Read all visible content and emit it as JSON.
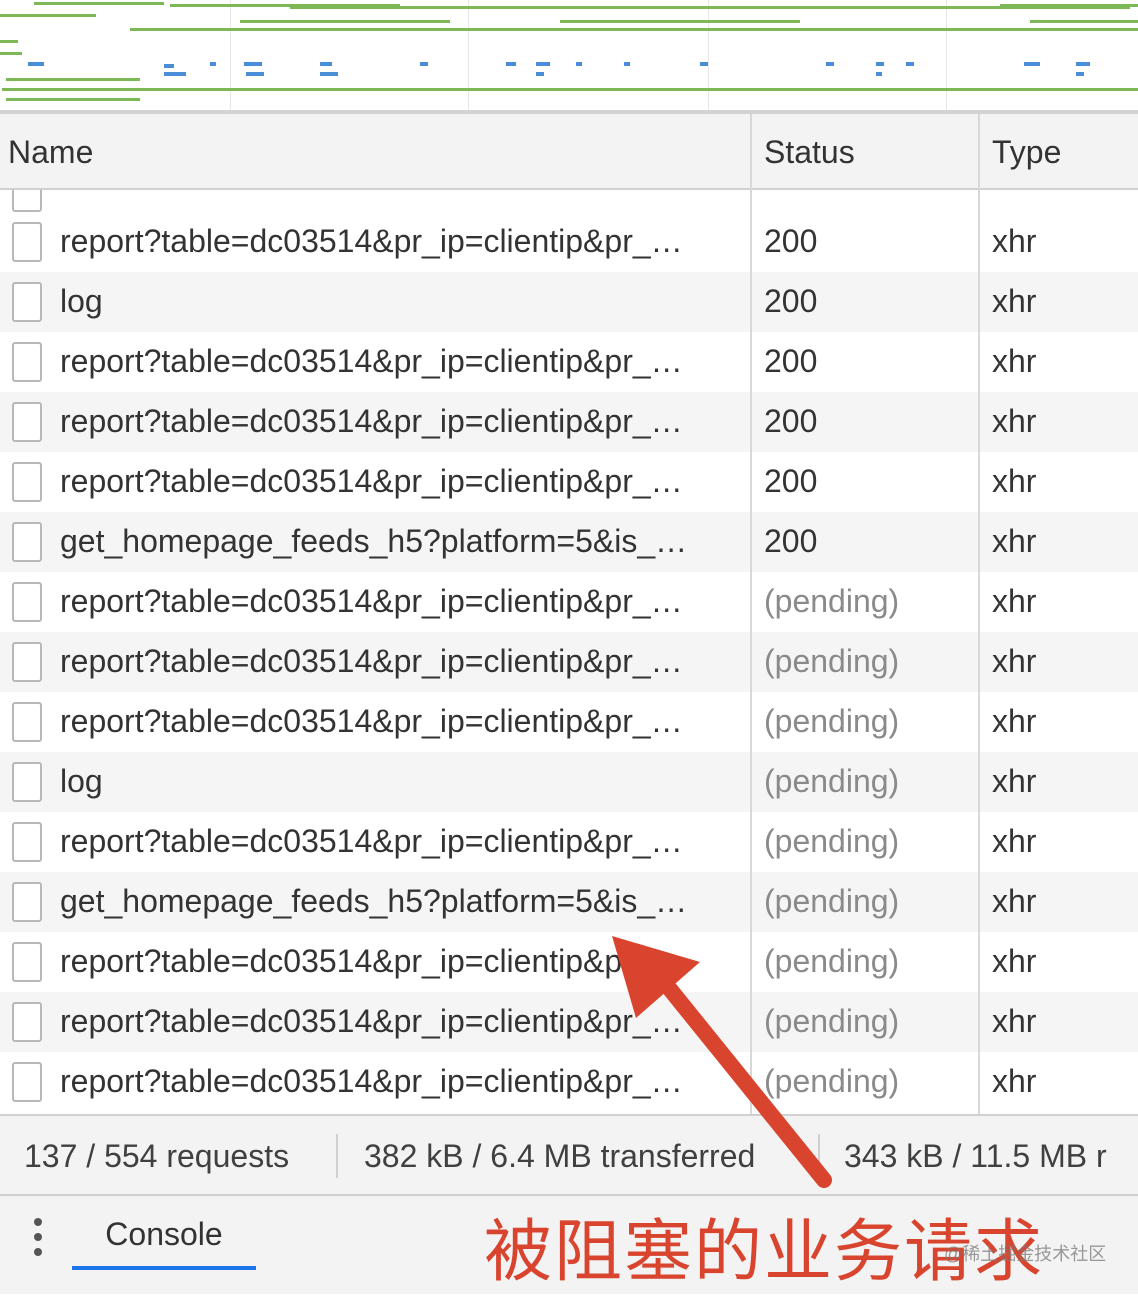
{
  "columns": {
    "name": "Name",
    "status": "Status",
    "type": "Type"
  },
  "rows": [
    {
      "name": "report?table=dc03514&pr_ip=clientip&pr_…",
      "status": "200",
      "type": "xhr"
    },
    {
      "name": "log",
      "status": "200",
      "type": "xhr"
    },
    {
      "name": "report?table=dc03514&pr_ip=clientip&pr_…",
      "status": "200",
      "type": "xhr"
    },
    {
      "name": "report?table=dc03514&pr_ip=clientip&pr_…",
      "status": "200",
      "type": "xhr"
    },
    {
      "name": "report?table=dc03514&pr_ip=clientip&pr_…",
      "status": "200",
      "type": "xhr"
    },
    {
      "name": "get_homepage_feeds_h5?platform=5&is_…",
      "status": "200",
      "type": "xhr"
    },
    {
      "name": "report?table=dc03514&pr_ip=clientip&pr_…",
      "status": "(pending)",
      "type": "xhr"
    },
    {
      "name": "report?table=dc03514&pr_ip=clientip&pr_…",
      "status": "(pending)",
      "type": "xhr"
    },
    {
      "name": "report?table=dc03514&pr_ip=clientip&pr_…",
      "status": "(pending)",
      "type": "xhr"
    },
    {
      "name": "log",
      "status": "(pending)",
      "type": "xhr"
    },
    {
      "name": "report?table=dc03514&pr_ip=clientip&pr_…",
      "status": "(pending)",
      "type": "xhr"
    },
    {
      "name": "get_homepage_feeds_h5?platform=5&is_…",
      "status": "(pending)",
      "type": "xhr"
    },
    {
      "name": "report?table=dc03514&pr_ip=clientip&pr_…",
      "status": "(pending)",
      "type": "xhr"
    },
    {
      "name": "report?table=dc03514&pr_ip=clientip&pr_…",
      "status": "(pending)",
      "type": "xhr"
    },
    {
      "name": "report?table=dc03514&pr_ip=clientip&pr_…",
      "status": "(pending)",
      "type": "xhr"
    }
  ],
  "summary": {
    "requests": "137 / 554 requests",
    "transferred": "382 kB / 6.4 MB transferred",
    "resources": "343 kB / 11.5 MB r"
  },
  "drawer": {
    "console_tab": "Console"
  },
  "annotation": {
    "callout_text": "被阻塞的业务请求",
    "watermark": "@稀土掘金技术社区",
    "color": "#d9442e"
  },
  "colors": {
    "waterfall_green": "#7cb855",
    "waterfall_blue": "#4a8ed8",
    "tab_underline": "#1a73e8"
  },
  "icons": {
    "drawer_menu": "kebab-menu-icon",
    "row_icon": "file-icon"
  }
}
